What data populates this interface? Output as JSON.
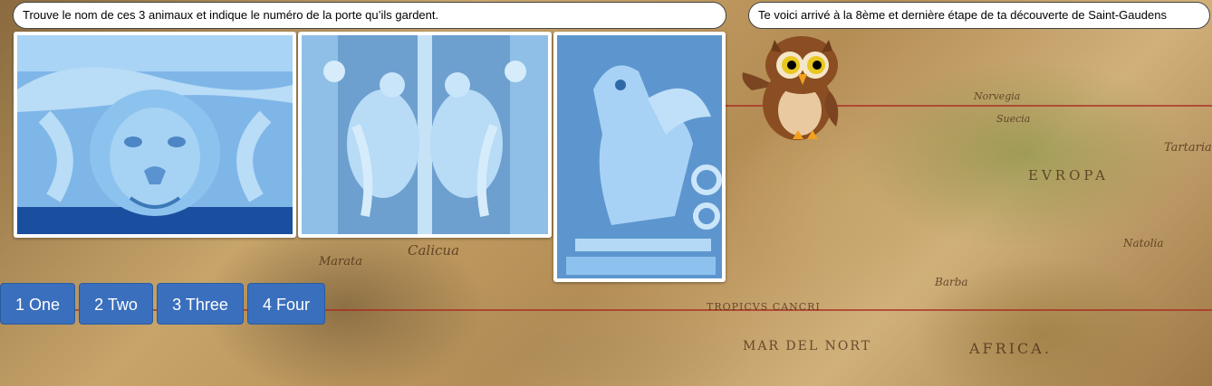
{
  "left_bubble": {
    "text": "Trouve le nom de ces 3 animaux et indique le numéro de la porte qu’ils gardent."
  },
  "right_bubble": {
    "text": "Te voici arrivé à la 8ème et dernière étape de ta découverte de Saint-Gaudens"
  },
  "photos": [
    {
      "icon": "lion-head-icon"
    },
    {
      "icon": "eagles-icon"
    },
    {
      "icon": "griffin-icon"
    }
  ],
  "buttons": [
    {
      "label": "1 One"
    },
    {
      "label": "2 Two"
    },
    {
      "label": "3 Three"
    },
    {
      "label": "4 Four"
    }
  ],
  "map_labels": {
    "calicua": "Calicua",
    "marata": "Marata",
    "tropicus": "TROPICVS CANCRI",
    "mare": "MAR DEL NORT",
    "africa": "AFRICA.",
    "barba": "Barba",
    "natolia": "Natolia",
    "tartaria": "Tartaria",
    "europa": "EVROPA",
    "suecia": "Suecia",
    "norvegia": "Norvegia"
  },
  "colors": {
    "button_bg": "#3a6fbd",
    "photo_tint": "#9cc8ee",
    "owl_brown": "#8a4e22"
  }
}
